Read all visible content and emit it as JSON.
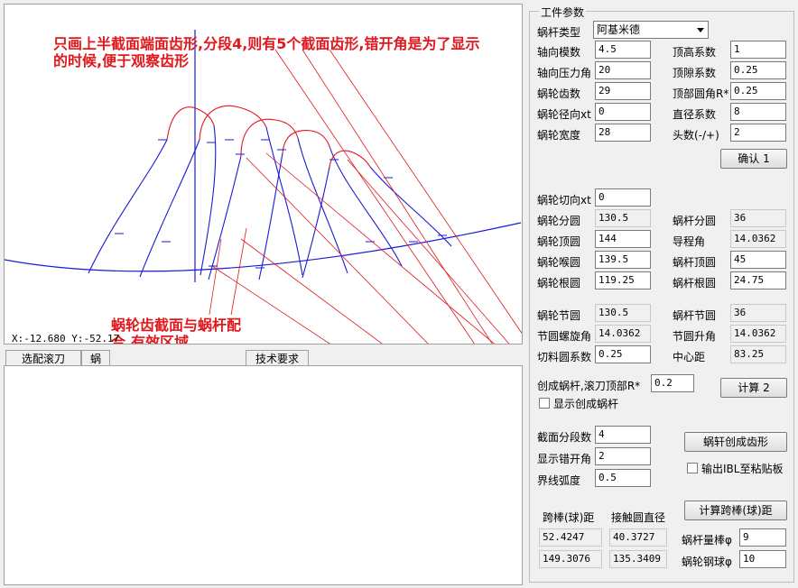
{
  "canvas": {
    "coord_readout": "X:-12.680 Y:-52.17"
  },
  "annotations": {
    "top_note": "只画上半截面端面齿形,分段4,则有5个截面齿形,错开角是为了显示的时候,便于观察齿形",
    "bottom_note": "蜗轮齿截面与蜗杆配合,有效区域"
  },
  "tabs": [
    {
      "label": "选配滚刀"
    },
    {
      "label": "蜗"
    },
    {
      "label": "技术要求"
    }
  ],
  "params": {
    "group_title": "工件参数",
    "worm_type_label": "蜗杆类型",
    "worm_type_value": "阿基米德",
    "axial_module_label": "轴向模数",
    "axial_module_value": "4.5",
    "axial_pressure_label": "轴向压力角",
    "axial_pressure_value": "20",
    "gear_teeth_label": "蜗轮齿数",
    "gear_teeth_value": "29",
    "radial_xt_label": "蜗轮径向xt",
    "radial_xt_value": "0",
    "gear_width_label": "蜗轮宽度",
    "gear_width_value": "28",
    "addendum_label": "顶高系数",
    "addendum_value": "1",
    "clearance_label": "顶隙系数",
    "clearance_value": "0.25",
    "tip_radius_label": "顶部圆角R*",
    "tip_radius_value": "0.25",
    "diameter_coef_label": "直径系数",
    "diameter_coef_value": "8",
    "starts_label": "头数(-/+)",
    "starts_value": "2",
    "confirm_button": "确认 1",
    "tangential_xt_label": "蜗轮切向xt",
    "tangential_xt_value": "0",
    "gear_pitch_label": "蜗轮分圆",
    "gear_pitch_value": "130.5",
    "gear_tip_label": "蜗轮顶圆",
    "gear_tip_value": "144",
    "gear_throat_label": "蜗轮喉圆",
    "gear_throat_value": "139.5",
    "gear_root_label": "蜗轮根圆",
    "gear_root_value": "119.25",
    "worm_pitch_label": "蜗杆分圆",
    "worm_pitch_value": "36",
    "lead_angle_label": "导程角",
    "lead_angle_value": "14.0362",
    "worm_tip_label": "蜗杆顶圆",
    "worm_tip_value": "45",
    "worm_root_label": "蜗杆根圆",
    "worm_root_value": "24.75",
    "gear_node_label": "蜗轮节圆",
    "gear_node_value": "130.5",
    "helix_angle_label": "节圆螺旋角",
    "helix_angle_value": "14.0362",
    "cut_coef_label": "切料圆系数",
    "cut_coef_value": "0.25",
    "worm_node_label": "蜗杆节圆",
    "worm_node_value": "36",
    "node_lift_label": "节圆升角",
    "node_lift_value": "14.0362",
    "center_dist_label": "中心距",
    "center_dist_value": "83.25",
    "hob_label": "创成蜗杆,滚刀顶部R*",
    "hob_value": "0.2",
    "calc_button": "计算 2",
    "show_worm_label": "显示创成蜗杆",
    "sections_label": "截面分段数",
    "sections_value": "4",
    "offset_label": "显示错开角",
    "offset_value": "2",
    "boundary_label": "界线弧度",
    "boundary_value": "0.5",
    "generate_button": "蜗轩创成齿形",
    "export_label": "输出IBL至粘贴板",
    "span_header": "跨棒(球)距",
    "contact_header": "接触圆直径",
    "span1": "52.4247",
    "span2": "149.3076",
    "contact1": "40.3727",
    "contact2": "135.3409",
    "calc_span_button": "计算跨棒(球)距",
    "worm_rod_label": "蜗杆量棒φ",
    "worm_rod_value": "9",
    "gear_ball_label": "蜗轮钢球φ",
    "gear_ball_value": "10"
  },
  "colors": {
    "profile_blue": "#1a1ad6",
    "tip_red": "#e0181e",
    "annotation_red": "#e0181e"
  }
}
